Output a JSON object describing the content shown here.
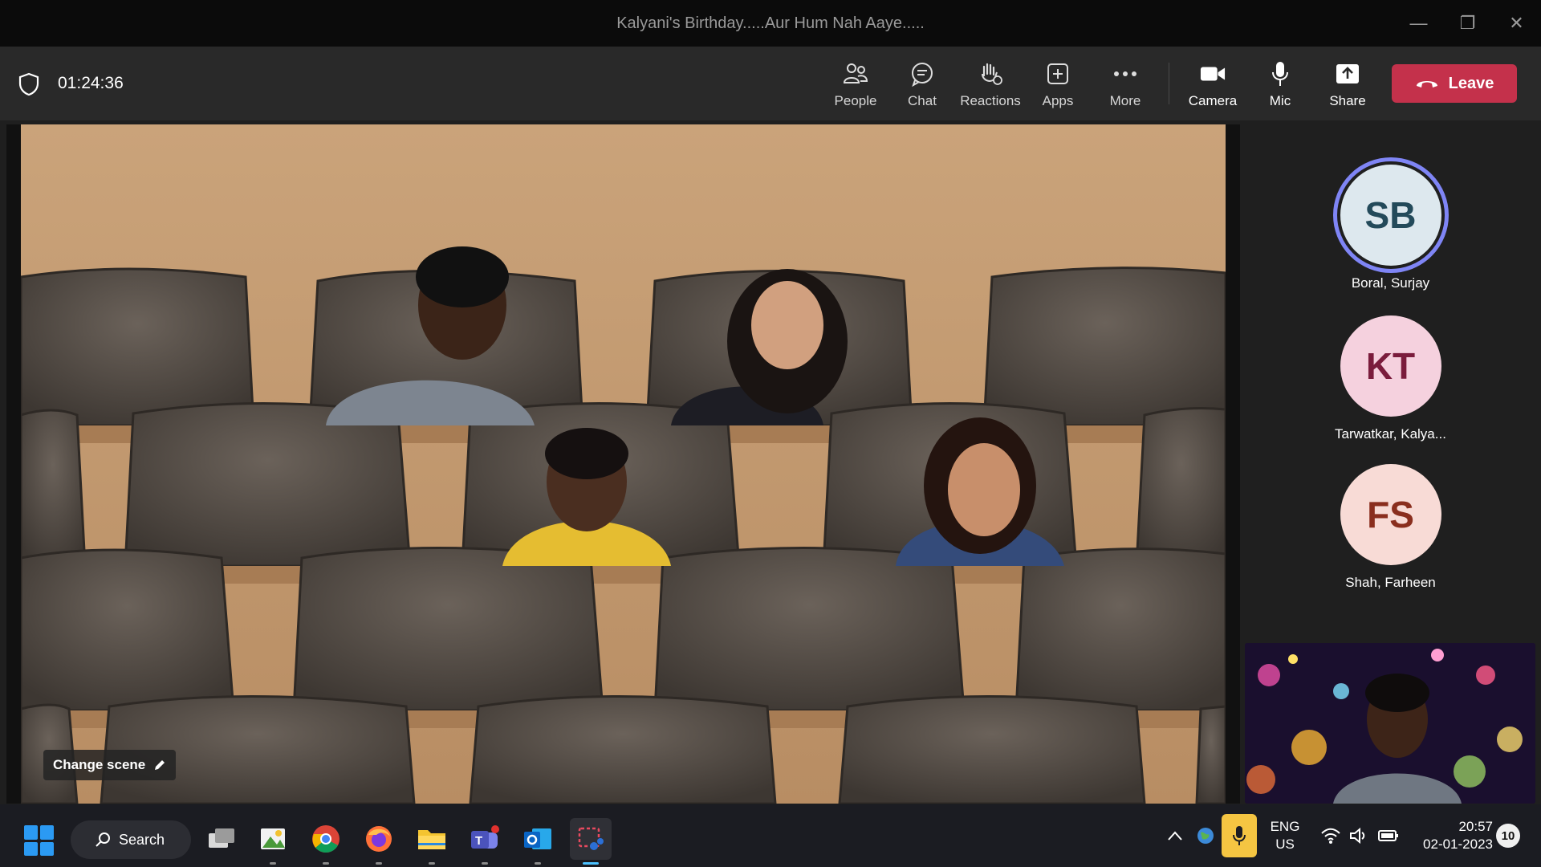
{
  "window": {
    "title": "Kalyani's Birthday.....Aur Hum Nah Aaye....."
  },
  "meeting": {
    "timer": "01:24:36",
    "change_scene_label": "Change scene"
  },
  "toolbar": {
    "people": "People",
    "chat": "Chat",
    "reactions": "Reactions",
    "apps": "Apps",
    "more": "More",
    "camera": "Camera",
    "mic": "Mic",
    "share": "Share",
    "leave": "Leave"
  },
  "participants": [
    {
      "initials": "SB",
      "name": "Boral, Surjay",
      "bg": "#dde8ee",
      "fg": "#234a5a",
      "speaking": true
    },
    {
      "initials": "KT",
      "name": "Tarwatkar, Kalya...",
      "bg": "#f5d1de",
      "fg": "#7a1c3c",
      "speaking": false
    },
    {
      "initials": "FS",
      "name": "Shah, Farheen",
      "bg": "#f8dbd6",
      "fg": "#8a2e1e",
      "speaking": false
    }
  ],
  "taskbar": {
    "search_label": "Search",
    "apps": [
      "task-view",
      "photo-editor",
      "chrome",
      "firefox",
      "file-explorer",
      "teams",
      "outlook",
      "snipping-tool"
    ],
    "lang_top": "ENG",
    "lang_bottom": "US",
    "time": "20:57",
    "date": "02-01-2023",
    "notifications": "10"
  },
  "colors": {
    "leave": "#c4314b",
    "speaking_ring": "#7f85f5",
    "taskbar": "#1b1c22"
  }
}
